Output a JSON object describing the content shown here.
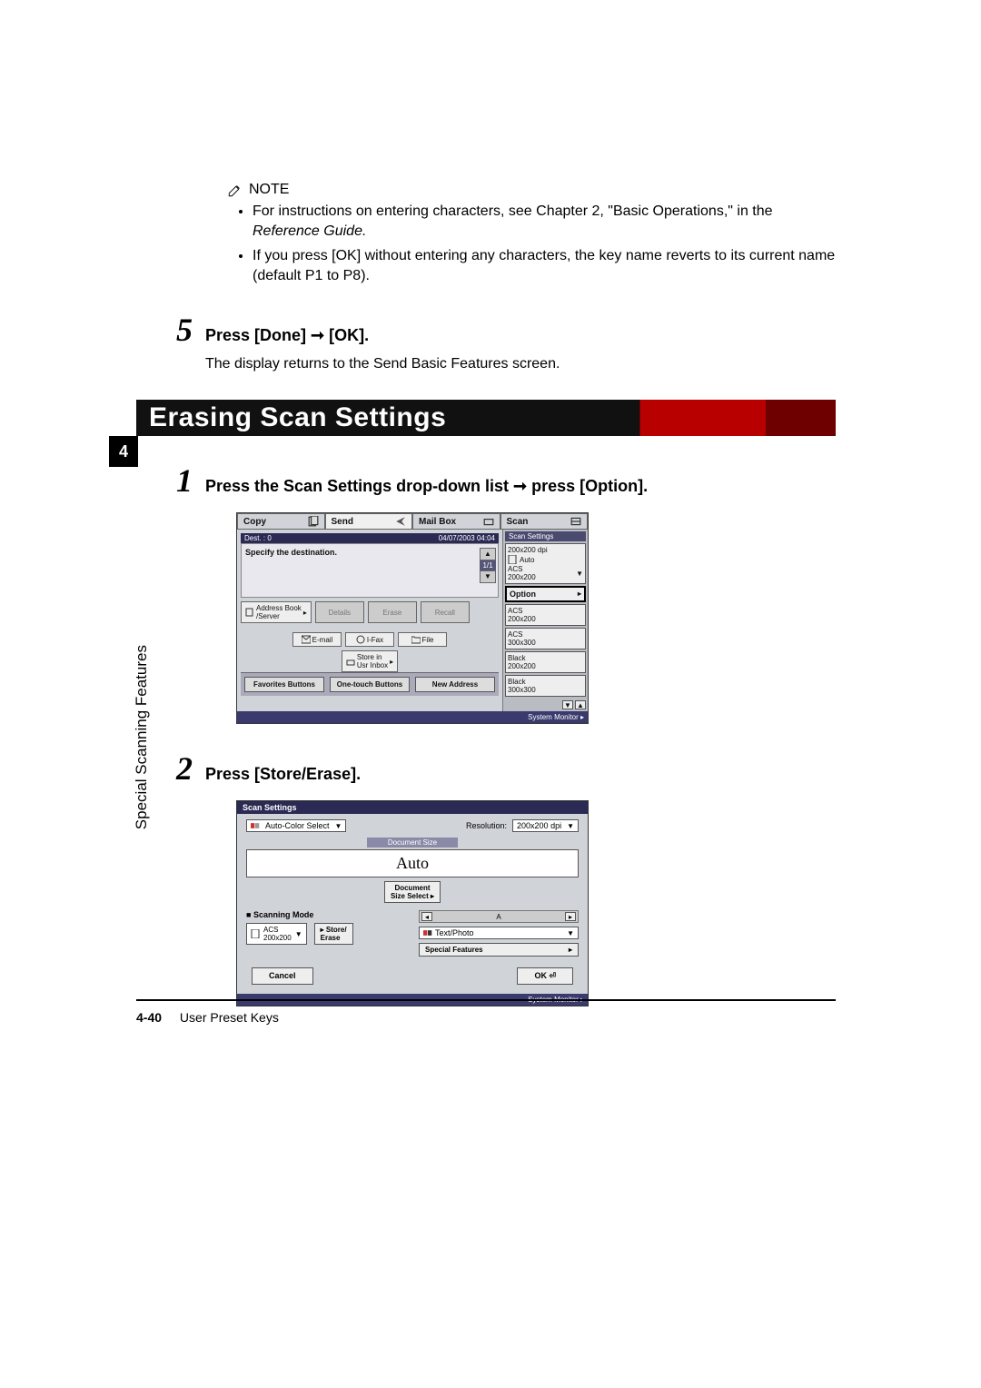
{
  "note": {
    "label": "NOTE",
    "items": [
      "For instructions on entering characters, see Chapter 2, \"Basic Operations,\" in the",
      "If you press [OK] without entering any characters, the key name reverts to its current name (default P1 to P8)."
    ],
    "ref_guide": "Reference Guide."
  },
  "step5": {
    "num": "5",
    "title": "Press [Done] ➞ [OK].",
    "body": "The display returns to the Send Basic Features screen."
  },
  "section_banner": "Erasing Scan Settings",
  "side": {
    "chapter_num": "4",
    "label": "Special Scanning Features"
  },
  "step1": {
    "num": "1",
    "title": "Press the Scan Settings drop-down list ➞ press [Option]."
  },
  "step2": {
    "num": "2",
    "title": "Press [Store/Erase]."
  },
  "screenshot1": {
    "tabs": {
      "copy": "Copy",
      "send": "Send",
      "mailbox": "Mail Box",
      "scan": "Scan"
    },
    "status_left": "Dest. :  0",
    "status_right": "04/07/2003 04:04",
    "specify": "Specify the destination.",
    "page_count": "1/1",
    "buttons": {
      "address_book": "Address Book\n/Server",
      "details": "Details",
      "erase": "Erase",
      "recall": "Recall",
      "email": "E-mail",
      "ifax": "I-Fax",
      "file": "File",
      "store_inbox": "Store in\nUsr Inbox"
    },
    "bottom": {
      "favorites": "Favorites Buttons",
      "onetouch": "One-touch Buttons",
      "newaddr": "New Address"
    },
    "side_panel": {
      "title": "Scan Settings",
      "res": "200x200 dpi",
      "auto": "Auto",
      "acs": "ACS\n200x200",
      "option": "Option",
      "preset_acs200": "ACS\n200x200",
      "preset_acs300": "ACS\n300x300",
      "preset_bw200": "Black\n200x200",
      "preset_bw300": "Black\n300x300"
    },
    "sysmon": "System Monitor"
  },
  "screenshot2": {
    "title": "Scan Settings",
    "color_mode": "Auto-Color Select",
    "res_label": "Resolution:",
    "res_value": "200x200 dpi",
    "doc_size_label": "Document Size",
    "auto": "Auto",
    "doc_size_select": "Document\nSize Select",
    "scanning_mode_label": "Scanning Mode",
    "acs": "ACS\n200x200",
    "store_erase": "Store/\nErase",
    "slider_a": "A",
    "textphoto": "Text/Photo",
    "special": "Special Features",
    "cancel": "Cancel",
    "ok": "OK",
    "sysmon": "System Monitor"
  },
  "footer": {
    "page": "4-40",
    "section": "User Preset Keys"
  }
}
